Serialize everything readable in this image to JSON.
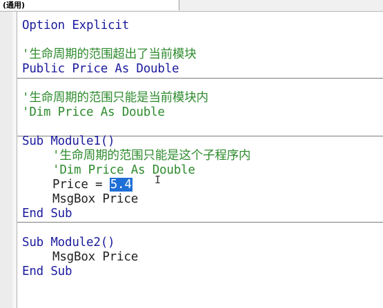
{
  "proc_dropdown": {
    "label": "(通用)"
  },
  "code_lines": [
    "Option Explicit",
    "",
    "'生命周期的范围超出了当前模块",
    "Public Price As Double",
    "",
    "'生命周期的范围只能是当前模块内",
    "'Dim Price As Double",
    "",
    "Sub Module1()",
    "'生命周期的范围只能是这个子程序内",
    "'Dim Price As Double",
    "Price = ",
    "5.4",
    "MsgBox Price",
    "End Sub",
    "",
    "Sub Module2()",
    "MsgBox Price",
    "End Sub"
  ],
  "colors": {
    "keyword": "#1b1b9e",
    "comment": "#2e8b2e",
    "selection": "#1f6fd6"
  }
}
